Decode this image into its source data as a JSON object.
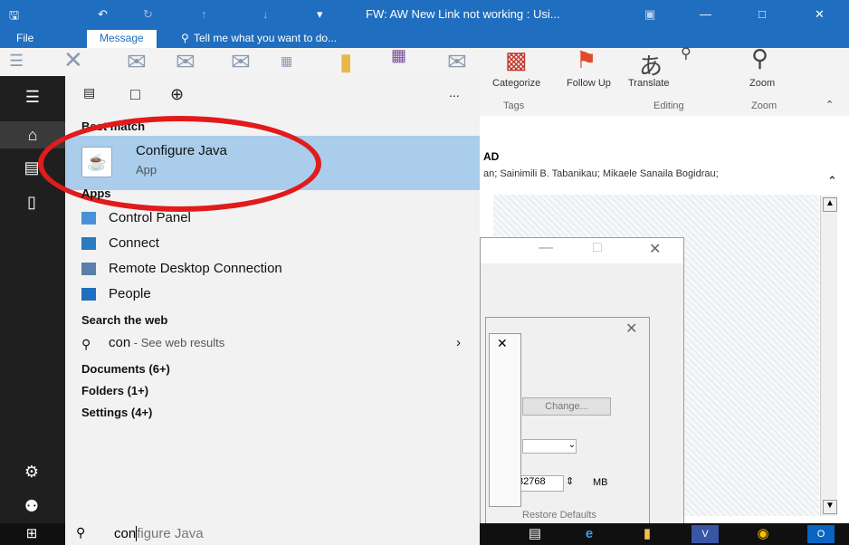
{
  "window": {
    "title": "FW: AW New Link not working : Usi...",
    "quick_access": [
      "save-icon",
      "undo-icon",
      "redo-icon",
      "up-icon",
      "down-icon",
      "customize-icon"
    ]
  },
  "ribbon": {
    "tabs": [
      {
        "label": "File"
      },
      {
        "label": "Message"
      },
      {
        "label": "Tell me what you want to do..."
      }
    ],
    "buttons": {
      "categorize": "Categorize",
      "follow_up": "Follow Up",
      "translate": "Translate",
      "zoom": "Zoom"
    },
    "groups": {
      "tags": "Tags",
      "editing": "Editing",
      "zoom": "Zoom"
    }
  },
  "reading_pane": {
    "subject_fragment": "AD",
    "recipients_fragment": "an; Sainimili B. Tabanikau; Mikaele Sanaila Bogidrau;",
    "dialog_button_change": "Change...",
    "dialog_value": "32768",
    "dialog_unit": "MB",
    "dialog_footer_fragment": "Restore Defaults"
  },
  "start": {
    "best_match_header": "Best match",
    "best_match": {
      "title": "Configure Java",
      "subtitle": "App"
    },
    "apps_header": "Apps",
    "apps": [
      {
        "label": "Control Panel",
        "icon": "control-panel-icon"
      },
      {
        "label": "Connect",
        "icon": "connect-icon"
      },
      {
        "label": "Remote Desktop Connection",
        "icon": "remote-desktop-icon"
      },
      {
        "label": "People",
        "icon": "people-icon"
      }
    ],
    "web_header": "Search the web",
    "web_query": "con",
    "web_suffix": " - See web results",
    "documents": "Documents (6+)",
    "folders": "Folders (1+)",
    "settings": "Settings (4+)",
    "more_label": "..."
  },
  "search": {
    "typed": "con",
    "completion": "figure Java"
  },
  "taskbar": {
    "items": [
      "start-icon",
      "task-view-icon",
      "edge-icon",
      "file-explorer-icon",
      "visio-icon",
      "chrome-icon",
      "outlook-icon"
    ]
  },
  "colors": {
    "outlook_blue": "#1f6ebf",
    "selection": "#a9cdeb",
    "annotation_red": "#e11b1b",
    "rail": "#1f1f1f"
  }
}
